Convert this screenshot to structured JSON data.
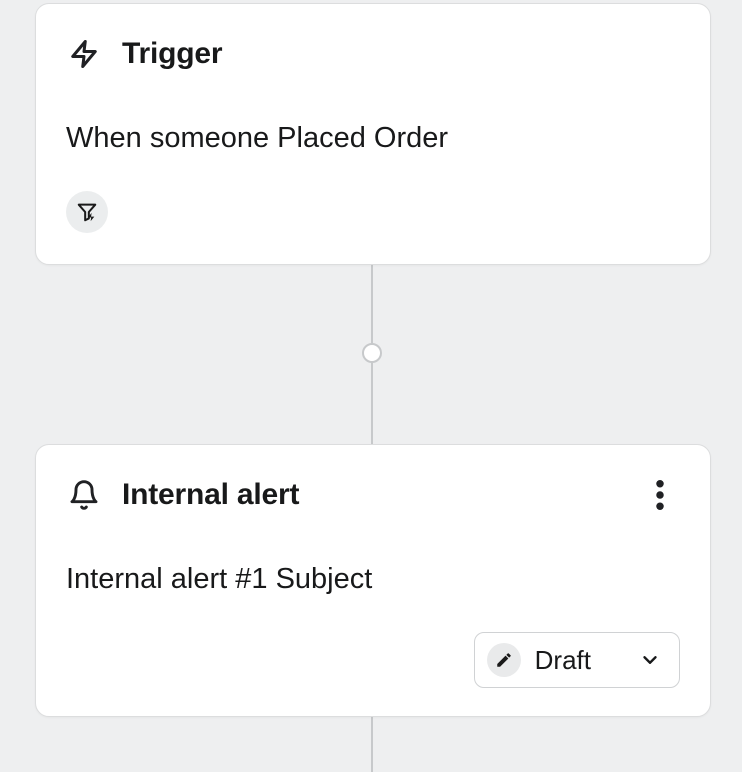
{
  "trigger": {
    "title": "Trigger",
    "description": "When someone Placed Order"
  },
  "alert": {
    "title": "Internal alert",
    "description": "Internal alert #1 Subject",
    "status_label": "Draft"
  }
}
